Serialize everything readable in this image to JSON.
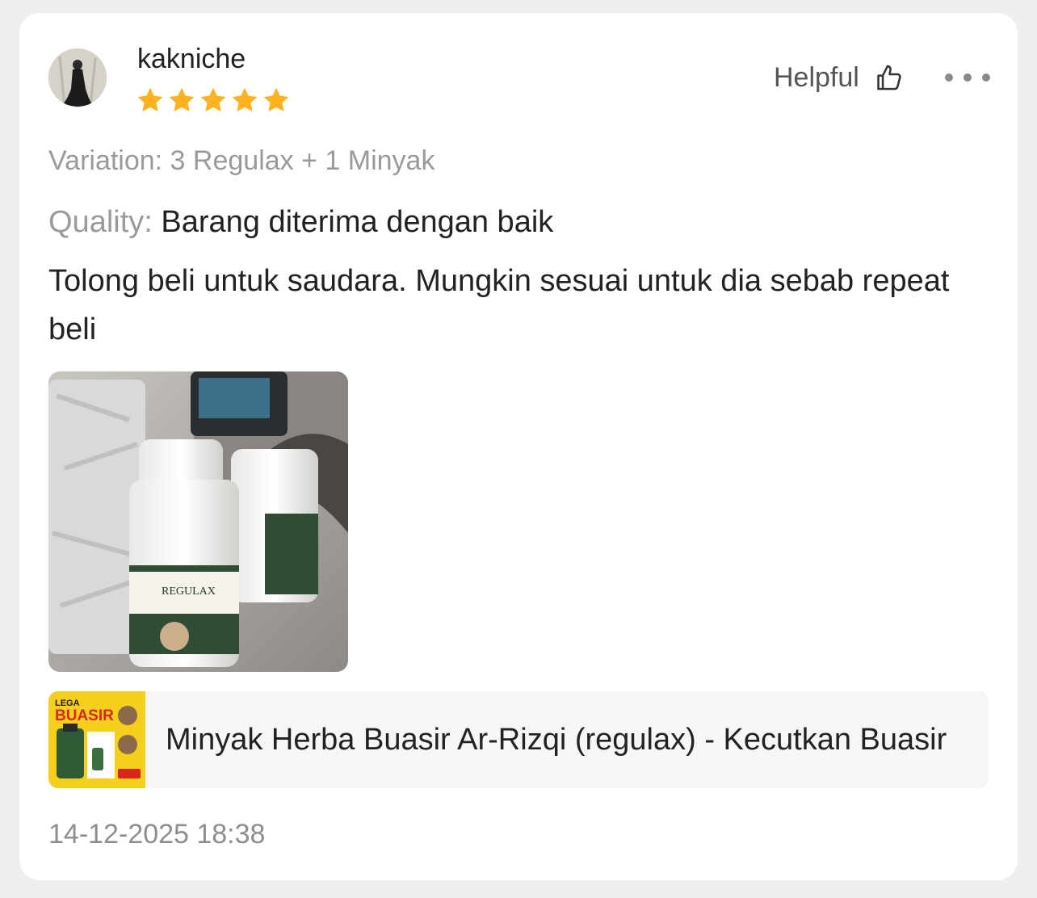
{
  "review": {
    "username": "kakniche",
    "rating": 5,
    "helpful_label": "Helpful",
    "variation_label": "Variation: 3 Regulax + 1 Minyak",
    "quality_label": "Quality:",
    "quality_value": "Barang diterima dengan baik",
    "text": "Tolong beli untuk saudara. Mungkin sesuai untuk dia sebab repeat beli",
    "date": "14-12-2025 18:38"
  },
  "product": {
    "title": "Minyak Herba Buasir Ar-Rizqi (regulax) - Kecutkan Buasir",
    "thumb_text_top": "LEGA",
    "thumb_text_main": "BUASIR"
  },
  "photo": {
    "label_text": "REGULAX"
  },
  "colors": {
    "star": "#ffb21d",
    "card": "#ffffff",
    "background": "#efefef",
    "thumb_yellow": "#f6cf1d"
  },
  "icons": {
    "helpful": "thumbs-up-icon",
    "more": "more-dots-icon",
    "star": "star-icon"
  }
}
